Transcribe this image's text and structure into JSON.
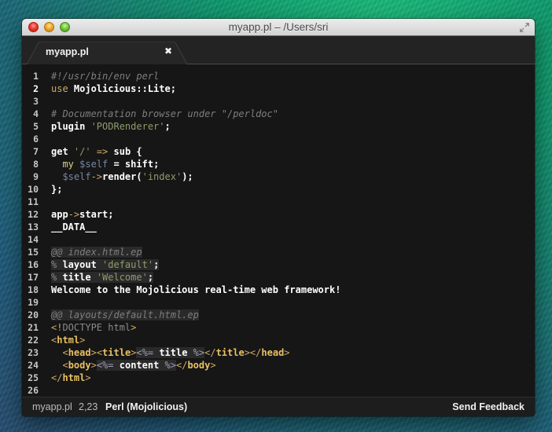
{
  "window": {
    "title": "myapp.pl – /Users/sri",
    "controls": [
      "close-icon",
      "minimize-icon",
      "zoom-icon"
    ],
    "fullscreen_icon": "fullscreen-arrows-icon"
  },
  "tabs": [
    {
      "label": "myapp.pl",
      "active": true,
      "close_glyph": "✖"
    }
  ],
  "editor": {
    "current_line": 2,
    "lines": [
      {
        "n": "1",
        "segs": [
          [
            "c-comment",
            "#!/usr/bin/env perl"
          ]
        ]
      },
      {
        "n": "2",
        "segs": [
          [
            "c-kw",
            "use"
          ],
          [
            "c-plain",
            " Mojolicious::Lite;"
          ]
        ]
      },
      {
        "n": "3",
        "segs": []
      },
      {
        "n": "4",
        "segs": [
          [
            "c-comment",
            "# Documentation browser under \"/perldoc\""
          ]
        ]
      },
      {
        "n": "5",
        "segs": [
          [
            "c-plain",
            "plugin "
          ],
          [
            "c-str",
            "'PODRenderer'"
          ],
          [
            "c-plain",
            ";"
          ]
        ]
      },
      {
        "n": "6",
        "segs": []
      },
      {
        "n": "7",
        "segs": [
          [
            "c-plain",
            "get "
          ],
          [
            "c-str",
            "'/'"
          ],
          [
            "c-plain",
            " "
          ],
          [
            "c-op",
            "=>"
          ],
          [
            "c-plain",
            " sub {"
          ]
        ]
      },
      {
        "n": "8",
        "segs": [
          [
            "c-plain",
            "  "
          ],
          [
            "c-my",
            "my"
          ],
          [
            "c-plain",
            " "
          ],
          [
            "c-var",
            "$self"
          ],
          [
            "c-plain",
            " = shift;"
          ]
        ]
      },
      {
        "n": "9",
        "segs": [
          [
            "c-plain",
            "  "
          ],
          [
            "c-var",
            "$self"
          ],
          [
            "c-op",
            "->"
          ],
          [
            "c-plain",
            "render("
          ],
          [
            "c-str",
            "'index'"
          ],
          [
            "c-plain",
            ");"
          ]
        ]
      },
      {
        "n": "10",
        "segs": [
          [
            "c-plain",
            "};"
          ]
        ]
      },
      {
        "n": "11",
        "segs": []
      },
      {
        "n": "12",
        "segs": [
          [
            "c-plain",
            "app"
          ],
          [
            "c-op",
            "->"
          ],
          [
            "c-plain",
            "start;"
          ]
        ]
      },
      {
        "n": "13",
        "segs": [
          [
            "c-plain",
            "__DATA__"
          ]
        ]
      },
      {
        "n": "14",
        "segs": []
      },
      {
        "n": "15",
        "segs": [
          [
            "c-comment hl",
            "@@ index.html.ep"
          ]
        ]
      },
      {
        "n": "16",
        "segs": [
          [
            "c-dim hl",
            "% "
          ],
          [
            "c-plain hl",
            "layout "
          ],
          [
            "c-str hl",
            "'default'"
          ],
          [
            "c-plain hl",
            ";"
          ]
        ]
      },
      {
        "n": "17",
        "segs": [
          [
            "c-dim hl",
            "% "
          ],
          [
            "c-plain hl",
            "title "
          ],
          [
            "c-str hl",
            "'Welcome'"
          ],
          [
            "c-plain hl",
            ";"
          ]
        ]
      },
      {
        "n": "18",
        "segs": [
          [
            "c-plain",
            "Welcome to the Mojolicious real-time web framework!"
          ]
        ]
      },
      {
        "n": "19",
        "segs": []
      },
      {
        "n": "20",
        "segs": [
          [
            "c-comment hl",
            "@@ layouts/default.html.ep"
          ]
        ]
      },
      {
        "n": "21",
        "segs": [
          [
            "c-tagp",
            "<!"
          ],
          [
            "c-dim",
            "DOCTYPE html"
          ],
          [
            "c-tagp",
            ">"
          ]
        ]
      },
      {
        "n": "22",
        "segs": [
          [
            "c-tagp",
            "<"
          ],
          [
            "c-tag",
            "html"
          ],
          [
            "c-tagp",
            ">"
          ]
        ]
      },
      {
        "n": "23",
        "segs": [
          [
            "c-plain",
            "  "
          ],
          [
            "c-tagp",
            "<"
          ],
          [
            "c-tag",
            "head"
          ],
          [
            "c-tagp",
            "><"
          ],
          [
            "c-tag",
            "title"
          ],
          [
            "c-tagp",
            ">"
          ],
          [
            "c-ep hl",
            "<%="
          ],
          [
            "c-plain hl",
            " title "
          ],
          [
            "c-ep hl",
            "%>"
          ],
          [
            "c-tagp",
            "</"
          ],
          [
            "c-tag",
            "title"
          ],
          [
            "c-tagp",
            "></"
          ],
          [
            "c-tag",
            "head"
          ],
          [
            "c-tagp",
            ">"
          ]
        ]
      },
      {
        "n": "24",
        "segs": [
          [
            "c-plain",
            "  "
          ],
          [
            "c-tagp",
            "<"
          ],
          [
            "c-tag",
            "body"
          ],
          [
            "c-tagp",
            ">"
          ],
          [
            "c-ep hl",
            "<%="
          ],
          [
            "c-plain hl",
            " content "
          ],
          [
            "c-ep hl",
            "%>"
          ],
          [
            "c-tagp",
            "</"
          ],
          [
            "c-tag",
            "body"
          ],
          [
            "c-tagp",
            ">"
          ]
        ]
      },
      {
        "n": "25",
        "segs": [
          [
            "c-tagp",
            "</"
          ],
          [
            "c-tag",
            "html"
          ],
          [
            "c-tagp",
            ">"
          ]
        ]
      },
      {
        "n": "26",
        "segs": []
      }
    ]
  },
  "statusbar": {
    "filename": "myapp.pl",
    "cursor_position": "2,23",
    "syntax": "Perl (Mojolicious)",
    "feedback_label": "Send Feedback"
  },
  "colors": {
    "editor_bg": "#161616",
    "comment": "#7e7e7e",
    "keyword": "#cda869",
    "string": "#8f9d6a",
    "variable": "#7587a6",
    "tag": "#e9c062"
  }
}
